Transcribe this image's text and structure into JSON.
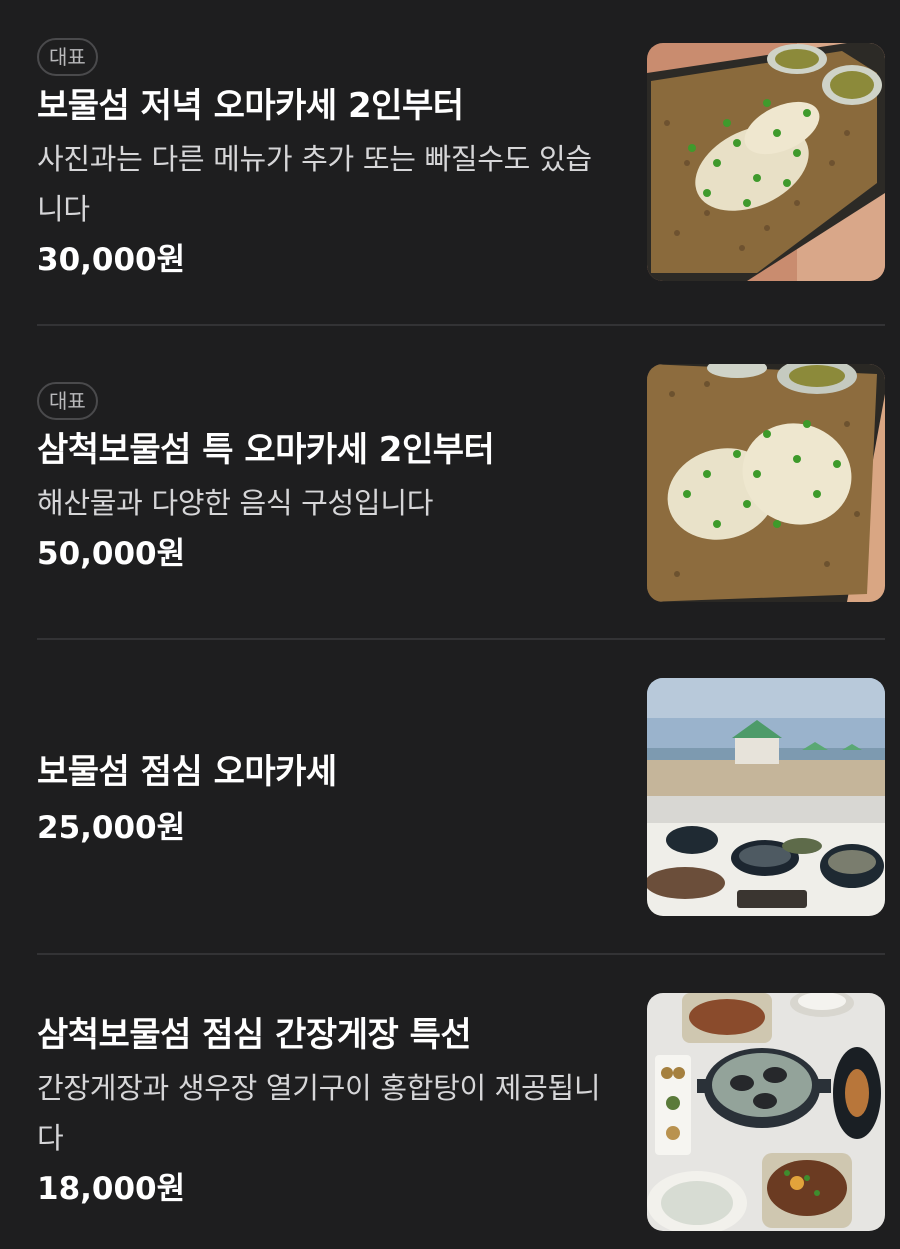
{
  "menu": {
    "items": [
      {
        "badge": "대표",
        "title": "보물섬 저녁 오마카세 2인부터",
        "description": "사진과는 다른 메뉴가 추가 또는 빠질수도 있습니다",
        "price": "30,000원",
        "image_icon": "seafood-rice-platter-photo"
      },
      {
        "badge": "대표",
        "title": "삼척보물섬 특 오마카세 2인부터",
        "description": "해산물과 다양한 음식 구성입니다",
        "price": "50,000원",
        "image_icon": "abalone-rice-platter-photo"
      },
      {
        "title": "보물섬 점심 오마카세",
        "price": "25,000원",
        "image_icon": "beach-view-table-photo"
      },
      {
        "title": "삼척보물섬 점심 간장게장 특선",
        "description": "간장게장과 생우장 열기구이 홍합탕이 제공됩니다",
        "price": "18,000원",
        "image_icon": "crab-set-meal-photo"
      }
    ]
  },
  "colors": {
    "background": "#1e1e1f",
    "divider": "#333335",
    "badge_border": "#4a4a4c",
    "title": "#ffffff",
    "description": "#d6d6d8"
  }
}
